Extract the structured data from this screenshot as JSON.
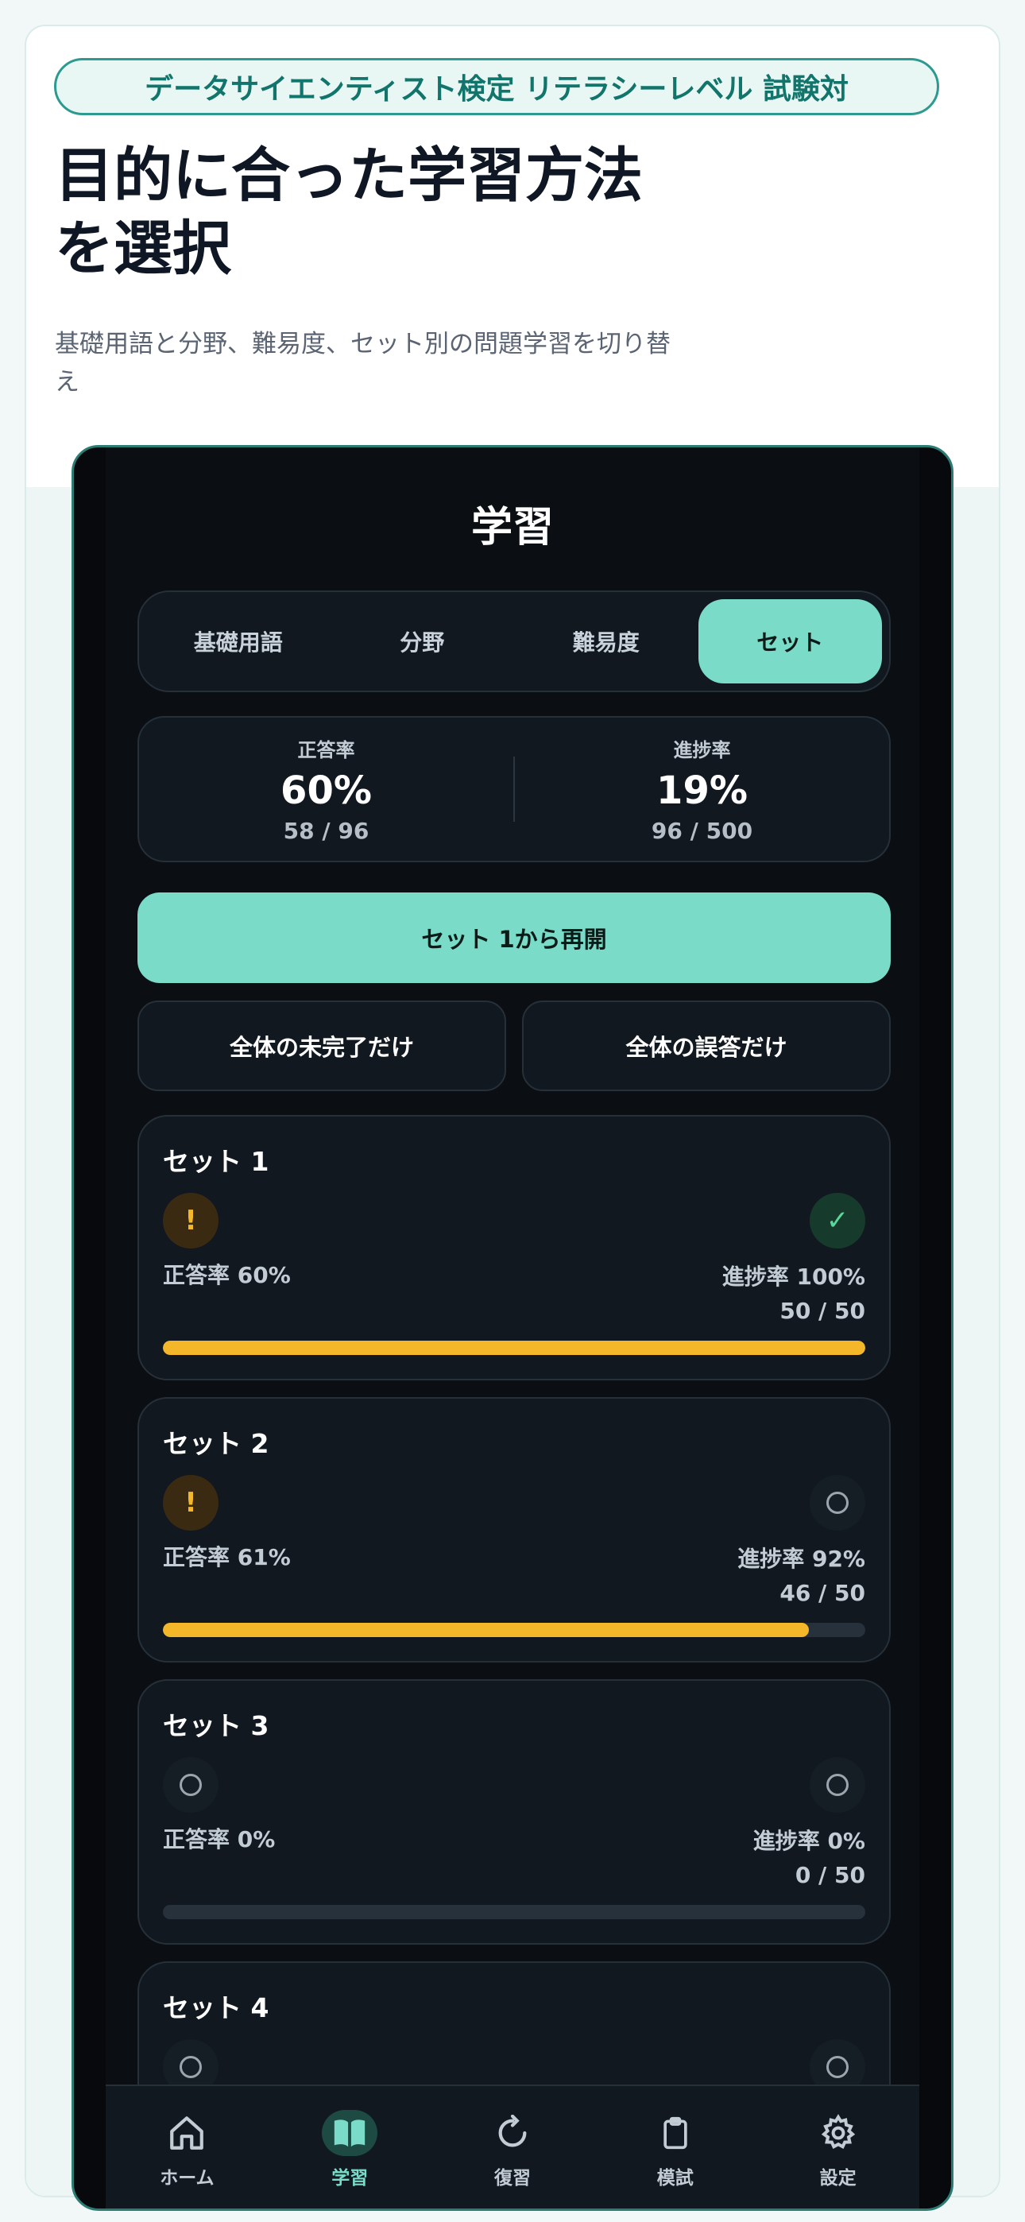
{
  "banner": {
    "pill": "データサイエンティスト検定 リテラシーレベル 試験対",
    "headline": "目的に合った学習方法を選択",
    "subtext": "基礎用語と分野、難易度、セット別の問題学習を切り替え"
  },
  "app": {
    "title": "学習",
    "segments": [
      "基礎用語",
      "分野",
      "難易度",
      "セット"
    ],
    "active_segment": "セット",
    "stats": {
      "accuracy_label": "正答率",
      "accuracy_value": "60%",
      "accuracy_sub": "58 / 96",
      "progress_label": "進捗率",
      "progress_value": "19%",
      "progress_sub": "96 / 500"
    },
    "resume_button": "セット 1から再開",
    "filter_incomplete": "全体の未完了だけ",
    "filter_wrong": "全体の誤答だけ",
    "sets": [
      {
        "title": "セット 1",
        "accuracy": "正答率 60%",
        "progress": "進捗率 100%",
        "count": "50 / 50",
        "progress_fraction": 1.0,
        "left_badge": "warn",
        "right_badge": "done"
      },
      {
        "title": "セット 2",
        "accuracy": "正答率 61%",
        "progress": "進捗率 92%",
        "count": "46 / 50",
        "progress_fraction": 0.92,
        "left_badge": "warn",
        "right_badge": "empty"
      },
      {
        "title": "セット 3",
        "accuracy": "正答率 0%",
        "progress": "進捗率 0%",
        "count": "0 / 50",
        "progress_fraction": 0.0,
        "left_badge": "empty",
        "right_badge": "empty"
      },
      {
        "title": "セット 4",
        "left_badge": "empty",
        "right_badge": "empty"
      }
    ],
    "tabbar": [
      {
        "label": "ホーム",
        "icon": "home-icon"
      },
      {
        "label": "学習",
        "icon": "book-icon"
      },
      {
        "label": "復習",
        "icon": "refresh-icon"
      },
      {
        "label": "模試",
        "icon": "clipboard-icon"
      },
      {
        "label": "設定",
        "icon": "gear-icon"
      }
    ],
    "active_tab": "学習",
    "colors": {
      "accent": "#79dbc8",
      "warning": "#f5b72a",
      "success": "#5ad79b",
      "background": "#0b0e12"
    }
  }
}
